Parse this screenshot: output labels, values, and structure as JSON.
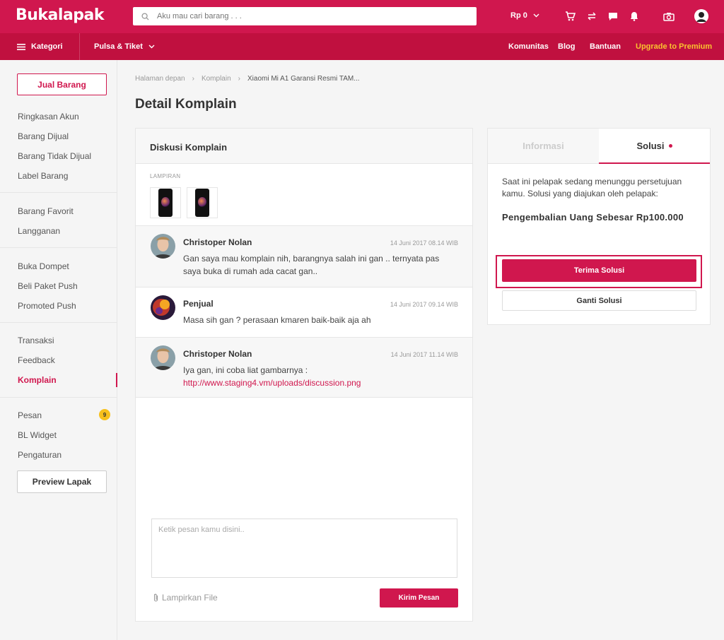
{
  "header": {
    "logo": "Bukalapak",
    "search_placeholder": "Aku mau cari barang . . .",
    "saldo": "Rp 0"
  },
  "subnav": {
    "kategori": "Kategori",
    "pulsa": "Pulsa & Tiket",
    "komunitas": "Komunitas",
    "blog": "Blog",
    "bantuan": "Bantuan",
    "premium": "Upgrade to Premium"
  },
  "sidebar": {
    "jual": "Jual Barang",
    "items": [
      "Ringkasan Akun",
      "Barang Dijual",
      "Barang Tidak Dijual",
      "Label Barang",
      "Barang Favorit",
      "Langganan",
      "Buka Dompet",
      "Beli Paket Push",
      "Promoted Push",
      "Transaksi",
      "Feedback",
      "Komplain",
      "Pesan",
      "BL Widget",
      "Pengaturan"
    ],
    "pesan_badge": "9",
    "preview": "Preview Lapak"
  },
  "breadcrumb": [
    "Halaman depan",
    "Komplain",
    "Xiaomi Mi A1 Garansi Resmi TAM..."
  ],
  "page_title": "Detail Komplain",
  "discussion": {
    "title": "Diskusi Komplain",
    "lampiran": "LAMPIRAN",
    "messages": [
      {
        "name": "Christoper Nolan",
        "time": "14 Juni 2017  08.14 WIB",
        "body": "Gan saya mau komplain nih, barangnya salah ini gan .. ternyata pas saya buka di rumah ada cacat gan.."
      },
      {
        "name": "Penjual",
        "time": "14 Juni 2017 09.14 WIB",
        "body": "Masa sih gan ?  perasaan kmaren baik-baik aja ah"
      },
      {
        "name": "Christoper Nolan",
        "time": "14 Juni 2017 11.14 WIB",
        "body": "Iya gan, ini coba liat gambarnya :",
        "link": "http://www.staging4.vm/uploads/discussion.png"
      }
    ],
    "input_placeholder": "Ketik pesan kamu disini..",
    "attach": "Lampirkan File",
    "send": "Kirim Pesan"
  },
  "solusi": {
    "tab_info": "Informasi",
    "tab_solusi": "Solusi",
    "text": "Saat ini pelapak sedang menunggu persetujuan kamu. Solusi yang diajukan oleh pelapak:",
    "amount": "Pengembalian Uang Sebesar Rp100.000",
    "accept": "Terima Solusi",
    "change": "Ganti Solusi"
  },
  "colors": {
    "brand": "#d0174e",
    "brand_dark": "#c0103f",
    "premium": "#fac22f",
    "badge": "#f7c01c"
  }
}
